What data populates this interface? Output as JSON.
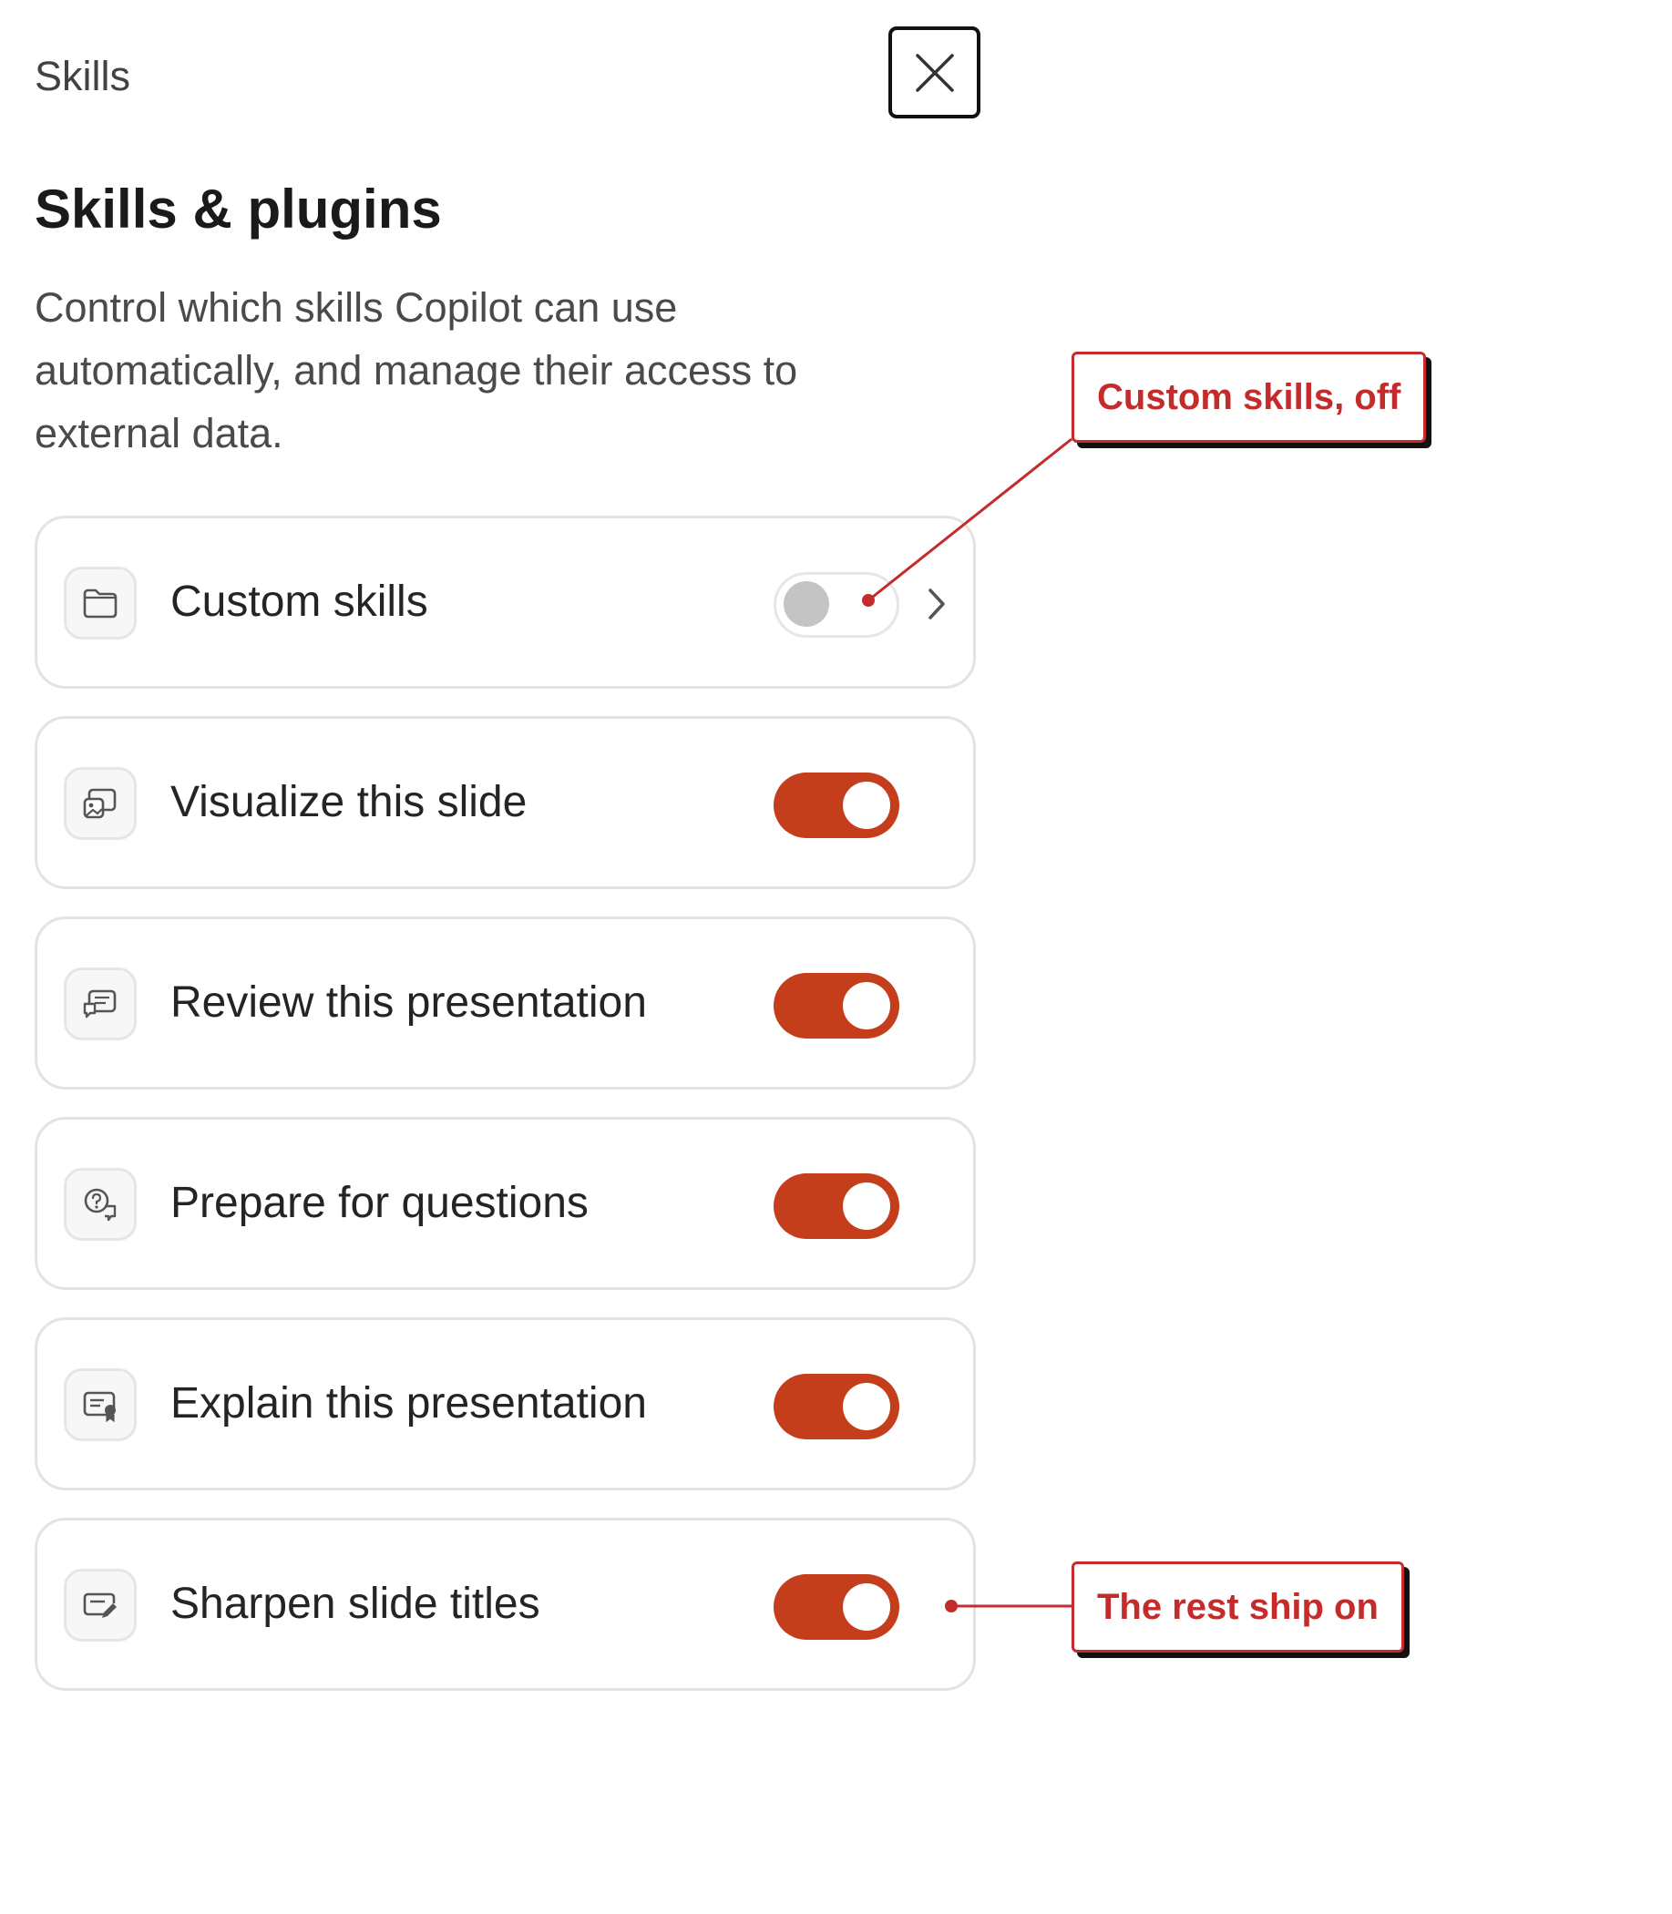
{
  "panel": {
    "title": "Skills",
    "close_label": "Close"
  },
  "header": {
    "heading": "Skills & plugins",
    "description": "Control which skills Copilot can use automatically, and manage their access to external data."
  },
  "skills": [
    {
      "label": "Custom skills",
      "icon": "folder-icon",
      "enabled": false,
      "has_chevron": true
    },
    {
      "label": "Visualize this slide",
      "icon": "slide-image-icon",
      "enabled": true,
      "has_chevron": false
    },
    {
      "label": "Review this presentation",
      "icon": "slide-comment-icon",
      "enabled": true,
      "has_chevron": false
    },
    {
      "label": "Prepare for questions",
      "icon": "question-bubble-icon",
      "enabled": true,
      "has_chevron": false
    },
    {
      "label": "Explain this presentation",
      "icon": "slide-ribbon-icon",
      "enabled": true,
      "has_chevron": false
    },
    {
      "label": "Sharpen slide titles",
      "icon": "slide-edit-icon",
      "enabled": true,
      "has_chevron": false
    }
  ],
  "annotations": [
    {
      "text": "Custom skills, off"
    },
    {
      "text": "The rest ship on"
    }
  ],
  "colors": {
    "toggle_on": "#c43e1c",
    "toggle_off_knob": "#c4c4c4",
    "annotation_red": "#c42b2b",
    "card_border": "#e3e3e3"
  }
}
